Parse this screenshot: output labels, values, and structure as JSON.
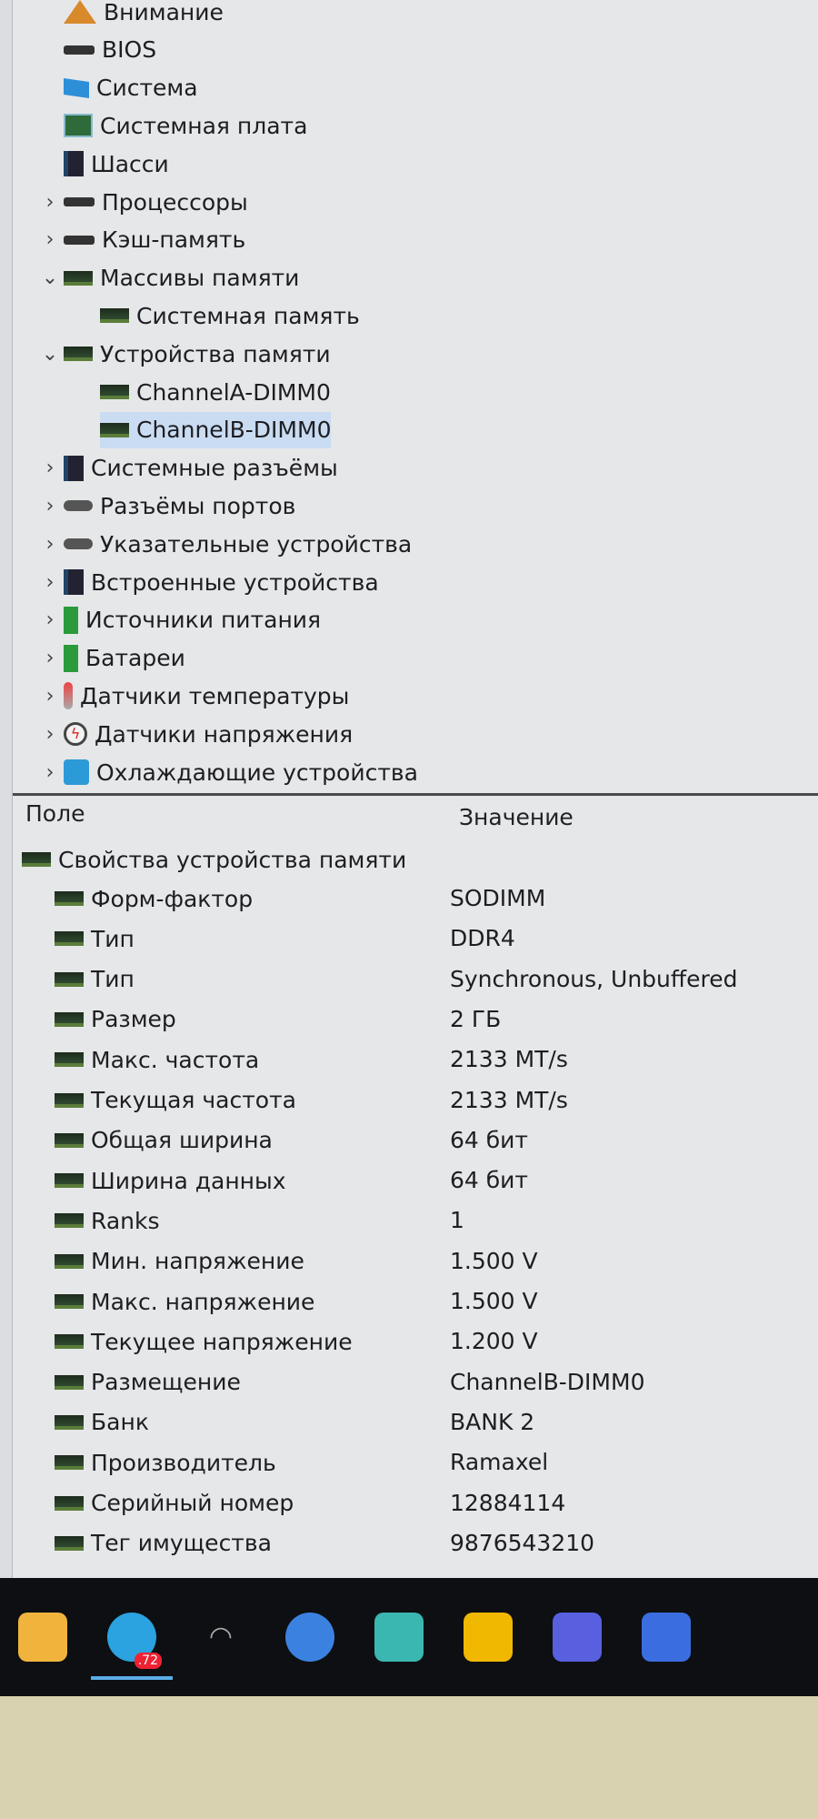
{
  "tree": [
    {
      "label": "Внимание",
      "icon": "warning-icon",
      "cls": "warn",
      "indent": 0,
      "chev": ""
    },
    {
      "label": "BIOS",
      "icon": "bios-chip-icon",
      "cls": "chip",
      "indent": 0,
      "chev": ""
    },
    {
      "label": "Система",
      "icon": "monitor-icon",
      "cls": "mon",
      "indent": 0,
      "chev": ""
    },
    {
      "label": "Системная плата",
      "icon": "motherboard-icon",
      "cls": "board",
      "indent": 0,
      "chev": ""
    },
    {
      "label": "Шасси",
      "icon": "chassis-icon",
      "cls": "case",
      "indent": 0,
      "chev": ""
    },
    {
      "label": "Процессоры",
      "icon": "cpu-icon",
      "cls": "chip",
      "indent": 0,
      "chev": "›"
    },
    {
      "label": "Кэш-память",
      "icon": "cache-icon",
      "cls": "chip",
      "indent": 0,
      "chev": "›"
    },
    {
      "label": "Массивы памяти",
      "icon": "memory-icon",
      "cls": "mem",
      "indent": 0,
      "chev": "⌄"
    },
    {
      "label": "Системная память",
      "icon": "memory-icon",
      "cls": "mem",
      "indent": 1,
      "chev": ""
    },
    {
      "label": "Устройства памяти",
      "icon": "memory-icon",
      "cls": "mem",
      "indent": 0,
      "chev": "⌄"
    },
    {
      "label": "ChannelA-DIMM0",
      "icon": "memory-icon",
      "cls": "mem",
      "indent": 1,
      "chev": ""
    },
    {
      "label": "ChannelB-DIMM0",
      "icon": "memory-icon",
      "cls": "mem",
      "indent": 1,
      "chev": "",
      "selected": true
    },
    {
      "label": "Системные разъёмы",
      "icon": "slot-icon",
      "cls": "case",
      "indent": 0,
      "chev": "›"
    },
    {
      "label": "Разъёмы портов",
      "icon": "port-icon",
      "cls": "gray",
      "indent": 0,
      "chev": "›"
    },
    {
      "label": "Указательные устройства",
      "icon": "mouse-icon",
      "cls": "gray",
      "indent": 0,
      "chev": "›"
    },
    {
      "label": "Встроенные устройства",
      "icon": "onboard-device-icon",
      "cls": "case",
      "indent": 0,
      "chev": "›"
    },
    {
      "label": "Источники питания",
      "icon": "power-supply-icon",
      "cls": "green",
      "indent": 0,
      "chev": "›"
    },
    {
      "label": "Батареи",
      "icon": "battery-icon",
      "cls": "green",
      "indent": 0,
      "chev": "›"
    },
    {
      "label": "Датчики температуры",
      "icon": "thermometer-icon",
      "cls": "temp",
      "indent": 0,
      "chev": "›"
    },
    {
      "label": "Датчики напряжения",
      "icon": "voltage-icon",
      "cls": "volt",
      "indent": 0,
      "chev": "›"
    },
    {
      "label": "Охлаждающие устройства",
      "icon": "fan-icon",
      "cls": "fan",
      "indent": 0,
      "chev": "›"
    }
  ],
  "details": {
    "col_field": "Поле",
    "col_value": "Значение",
    "group": "Свойства устройства памяти",
    "rows": [
      [
        "Форм-фактор",
        "SODIMM"
      ],
      [
        "Тип",
        "DDR4"
      ],
      [
        "Тип",
        "Synchronous, Unbuffered"
      ],
      [
        "Размер",
        "2 ГБ"
      ],
      [
        "Макс. частота",
        "2133 MT/s"
      ],
      [
        "Текущая частота",
        "2133 MT/s"
      ],
      [
        "Общая ширина",
        "64 бит"
      ],
      [
        "Ширина данных",
        "64 бит"
      ],
      [
        "Ranks",
        "1"
      ],
      [
        "Мин. напряжение",
        "1.500 V"
      ],
      [
        "Макс. напряжение",
        "1.500 V"
      ],
      [
        "Текущее напряжение",
        "1.200 V"
      ],
      [
        "Размещение",
        "ChannelB-DIMM0"
      ],
      [
        "Банк",
        "BANK 2"
      ],
      [
        "Производитель",
        "Ramaxel"
      ],
      [
        "Серийный номер",
        "12884114"
      ],
      [
        "Тег имущества",
        "9876543210"
      ]
    ]
  },
  "taskbar": [
    {
      "name": "file-explorer-icon",
      "color": "#f0b43c"
    },
    {
      "name": "telegram-icon",
      "color": "#2aa3e0",
      "badge": ".72",
      "active": true
    },
    {
      "name": "wifi-icon",
      "color": "#0d0f12"
    },
    {
      "name": "chrome-icon",
      "color": "#3b82e0"
    },
    {
      "name": "app-icon",
      "color": "#3ab7b0"
    },
    {
      "name": "player-icon",
      "color": "#f0b800"
    },
    {
      "name": "kmplayer-icon",
      "color": "#5860e0"
    },
    {
      "name": "viber-icon",
      "color": "#3a6ee0"
    }
  ]
}
